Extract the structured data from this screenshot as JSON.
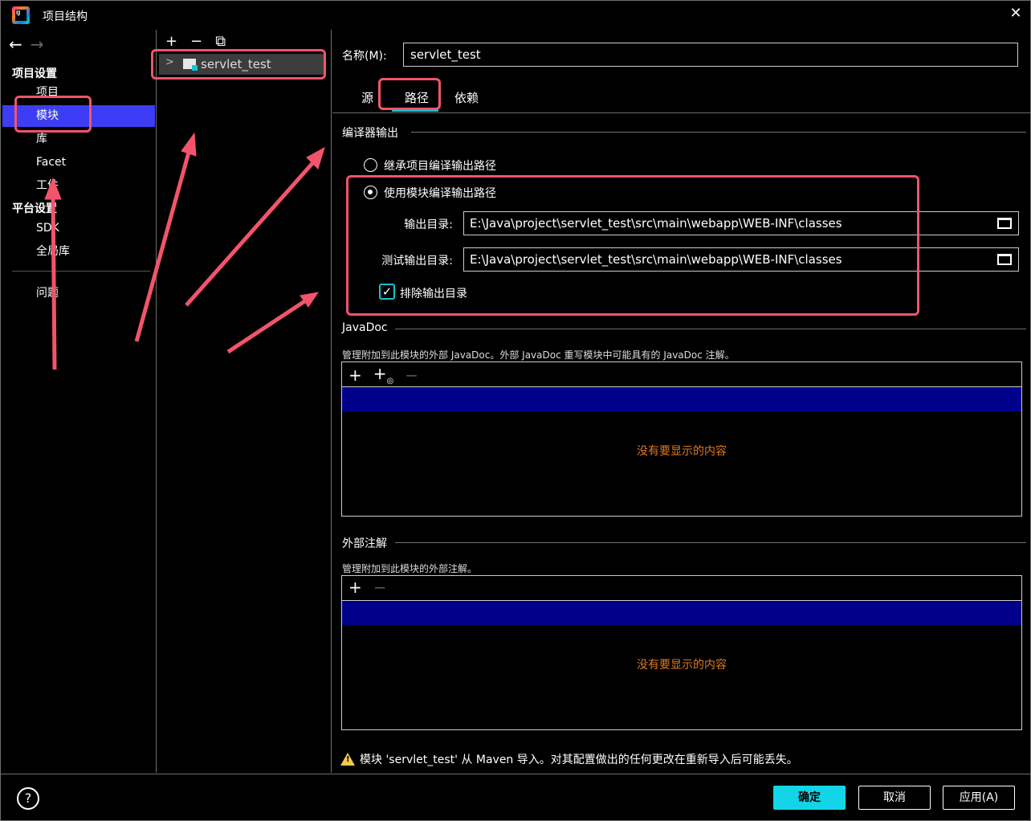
{
  "window": {
    "title": "项目结构",
    "close_glyph": "✕"
  },
  "nav": {
    "back": "←",
    "forward": "→",
    "project_settings": "项目设置",
    "platform_settings": "平台设置",
    "items": {
      "project": "项目",
      "modules": "模块",
      "libraries": "库",
      "facets": "Facet",
      "artifacts": "工件",
      "sdks": "SDK",
      "global_libraries": "全局库",
      "problems": "问题"
    }
  },
  "middle": {
    "toolbar": {
      "add": "+",
      "remove": "−",
      "copy": "⧉"
    },
    "tree": [
      {
        "label": "servlet_test"
      }
    ]
  },
  "module": {
    "name_label": "名称(M):",
    "name_value": "servlet_test",
    "tabs": [
      "源",
      "路径",
      "依赖"
    ],
    "active_tab": "路径"
  },
  "compiler_output": {
    "title": "编译器输出",
    "inherit_label": "继承项目编译输出路径",
    "use_module_label": "使用模块编译输出路径",
    "selected": "use_module",
    "output_dir_label": "输出目录:",
    "output_dir_value": "E:\\Java\\project\\servlet_test\\src\\main\\webapp\\WEB-INF\\classes",
    "test_output_dir_label": "测试输出目录:",
    "test_output_dir_value": "E:\\Java\\project\\servlet_test\\src\\main\\webapp\\WEB-INF\\classes",
    "exclude_label": "排除输出目录",
    "exclude_checked": true
  },
  "javadoc": {
    "title": "JavaDoc",
    "hint": "管理附加到此模块的外部 JavaDoc。外部 JavaDoc 重写模块中可能具有的 JavaDoc 注解。",
    "empty": "没有要显示的内容"
  },
  "annotations": {
    "title": "外部注解",
    "hint": "管理附加到此模块的外部注解。",
    "empty": "没有要显示的内容"
  },
  "warning": "模块 'servlet_test' 从 Maven 导入。对其配置做出的任何更改在重新导入后可能丢失。",
  "footer": {
    "help": "?",
    "ok": "确定",
    "cancel": "取消",
    "apply": "应用(A)"
  },
  "colors": {
    "accent": "#12d6e8",
    "selection": "#3d3df5",
    "annotation": "#f2546b",
    "empty_text": "#e07a1f"
  }
}
